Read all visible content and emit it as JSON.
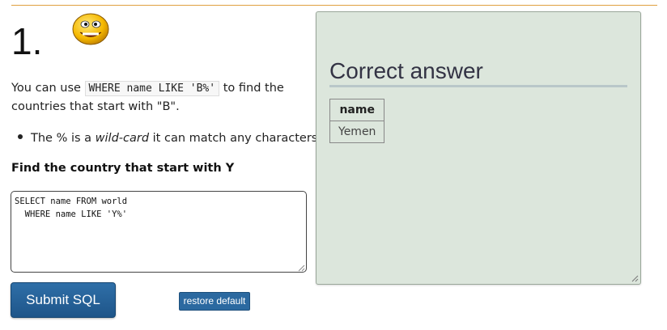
{
  "question": {
    "number": "1.",
    "intro_before": "You can use ",
    "intro_code": "WHERE name LIKE 'B%'",
    "intro_after": " to find the countries that start with \"B\".",
    "bullet_prefix": "The % is a ",
    "bullet_em": "wild-card",
    "bullet_suffix": " it can match any characters",
    "task": "Find the country that start with Y"
  },
  "editor": {
    "sql": "SELECT name FROM world\n  WHERE name LIKE 'Y%'"
  },
  "buttons": {
    "submit_label": "Submit SQL",
    "restore_label": "restore default"
  },
  "answer": {
    "title": "Correct answer",
    "columns": [
      "name"
    ],
    "rows": [
      [
        "Yemen"
      ]
    ]
  },
  "icons": {
    "smiley": "smiley-icon",
    "resize": "resize-grip-icon"
  },
  "colors": {
    "submit": "#2f6fa8",
    "panel_bg": "#dce6dc",
    "rule": "#e0a040"
  }
}
